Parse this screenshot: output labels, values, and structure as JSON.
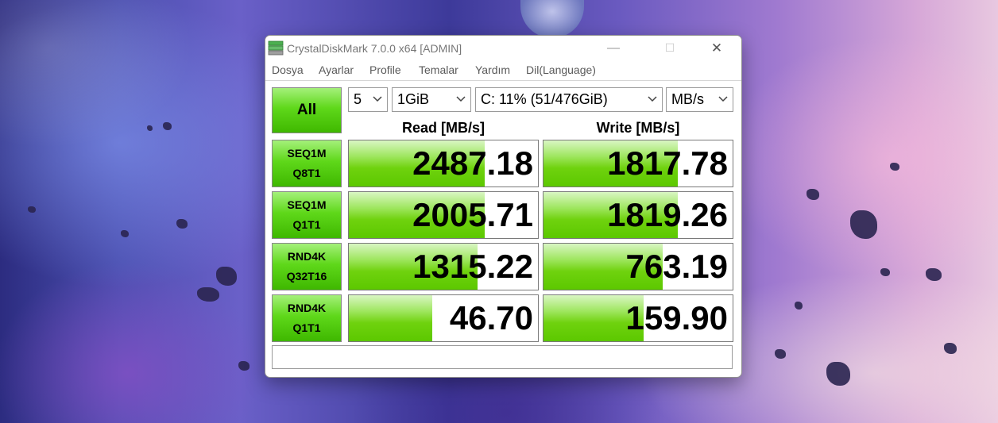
{
  "window": {
    "title": "CrystalDiskMark 7.0.0 x64 [ADMIN]",
    "minimize_glyph": "—",
    "maximize_glyph": "☐",
    "close_glyph": "✕"
  },
  "menu": [
    "Dosya",
    "Ayarlar",
    "Profile",
    "Temalar",
    "Yardım",
    "Dil(Language)"
  ],
  "controls": {
    "all_label": "All",
    "count": "5",
    "size": "1GiB",
    "drive": "C: 11% (51/476GiB)",
    "unit": "MB/s"
  },
  "headers": {
    "read": "Read [MB/s]",
    "write": "Write [MB/s]"
  },
  "accent_color": "#5cc800",
  "tests": [
    {
      "line1": "SEQ1M",
      "line2": "Q8T1",
      "read": "2487.18",
      "write": "1817.78",
      "read_fill": 0.72,
      "write_fill": 0.71
    },
    {
      "line1": "SEQ1M",
      "line2": "Q1T1",
      "read": "2005.71",
      "write": "1819.26",
      "read_fill": 0.72,
      "write_fill": 0.71
    },
    {
      "line1": "RND4K",
      "line2": "Q32T16",
      "read": "1315.22",
      "write": "763.19",
      "read_fill": 0.68,
      "write_fill": 0.63
    },
    {
      "line1": "RND4K",
      "line2": "Q1T1",
      "read": "46.70",
      "write": "159.90",
      "read_fill": 0.44,
      "write_fill": 0.53
    }
  ],
  "status_text": ""
}
